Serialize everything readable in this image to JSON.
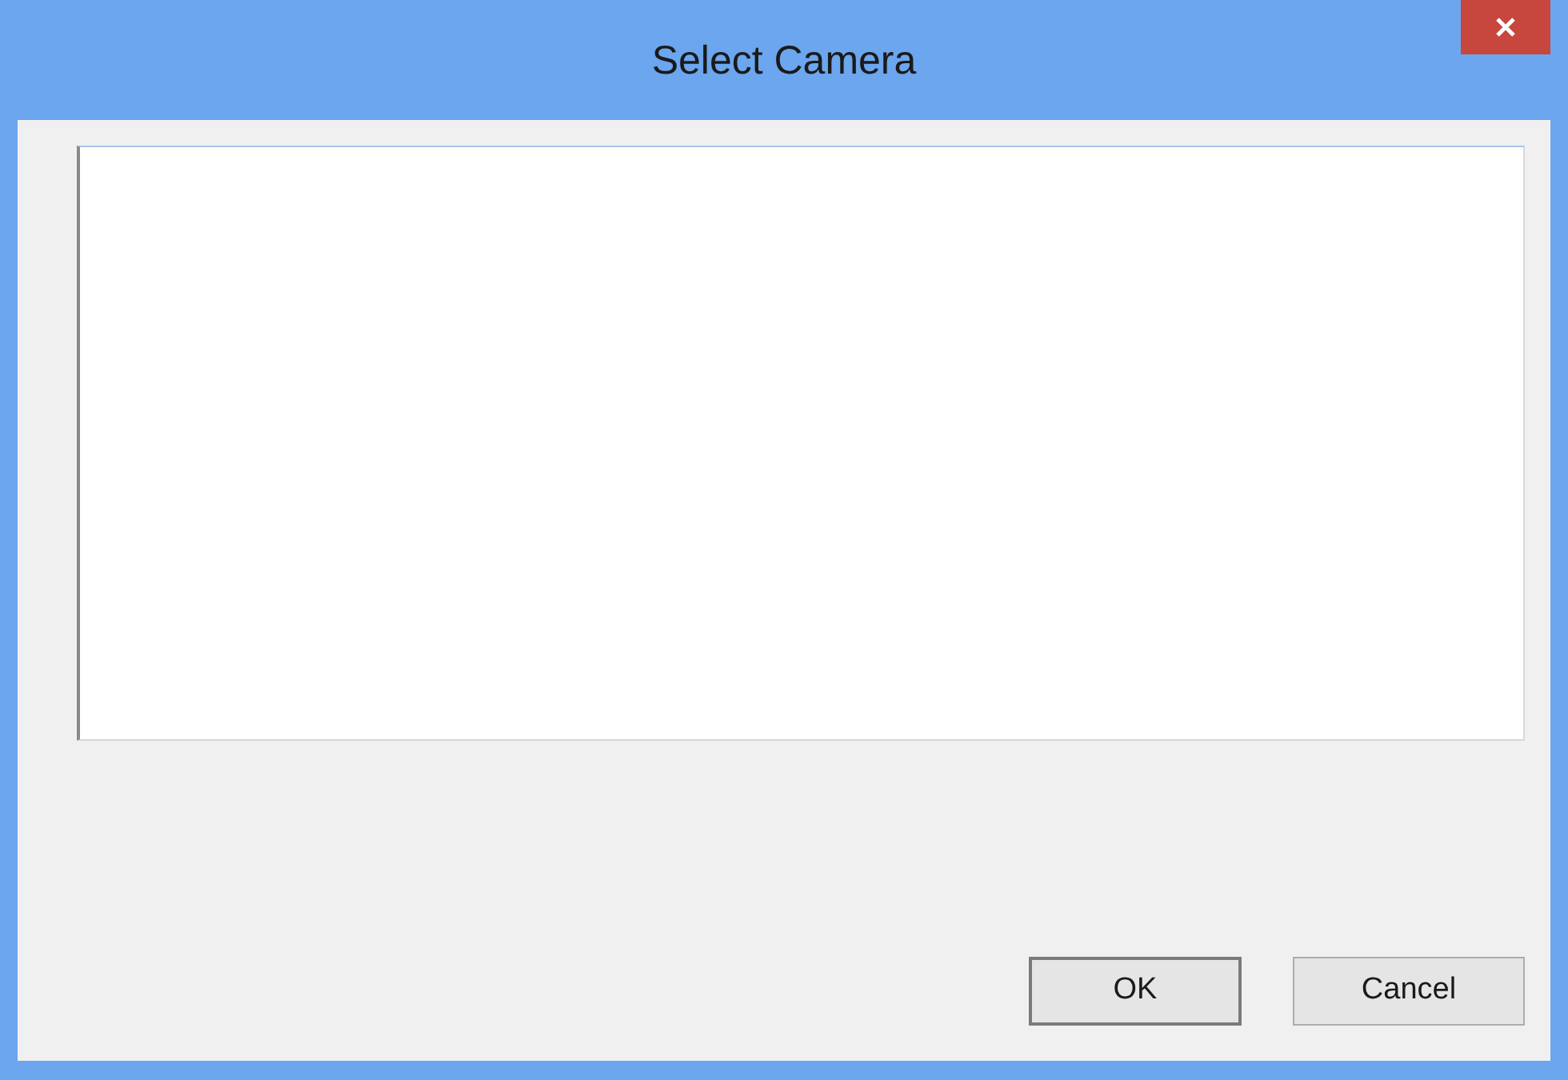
{
  "window": {
    "title": "Select Camera"
  },
  "buttons": [
    "OK",
    "Cancel"
  ]
}
